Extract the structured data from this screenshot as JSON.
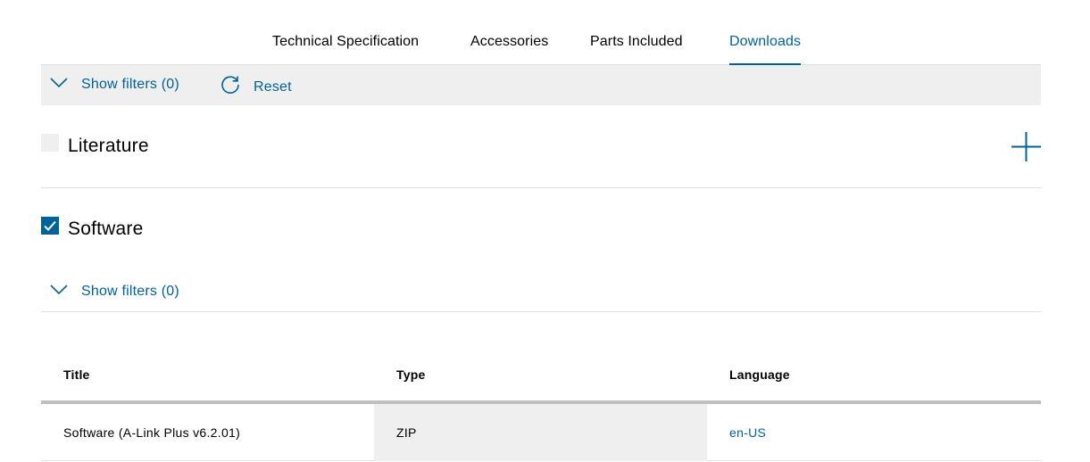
{
  "tabs": [
    {
      "label": "Technical Specification",
      "active": false
    },
    {
      "label": "Accessories",
      "active": false
    },
    {
      "label": "Parts Included",
      "active": false
    },
    {
      "label": "Downloads",
      "active": true
    }
  ],
  "top_filter": {
    "show_filters_label": "Show filters (0)",
    "reset_label": "Reset"
  },
  "sections": {
    "literature": {
      "title": "Literature",
      "checked": false
    },
    "software": {
      "title": "Software",
      "checked": true,
      "show_filters_label": "Show filters (0)"
    }
  },
  "table": {
    "headers": [
      "Title",
      "Type",
      "Language"
    ],
    "rows": [
      {
        "title": "Software (A-Link Plus v6.2.01)",
        "type": "ZIP",
        "language": "en-US"
      }
    ]
  },
  "colors": {
    "accent": "#00629a",
    "panel": "#efefef",
    "divider": "#e0e0e0",
    "header_rule": "#bfbfbf"
  },
  "icons": {
    "filter_toggle": "chevron-down-icon",
    "reset": "reset-icon",
    "expand": "plus-icon",
    "checked": "checkmark-icon"
  }
}
